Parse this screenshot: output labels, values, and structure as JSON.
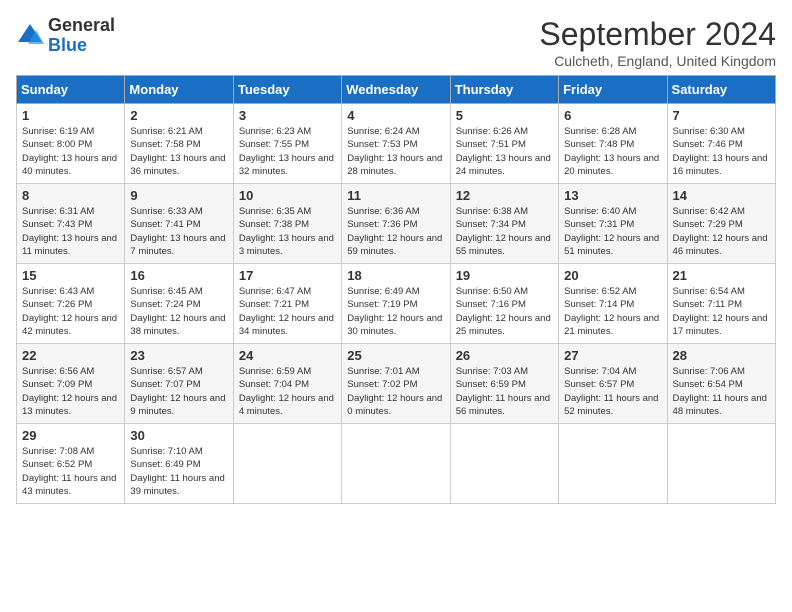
{
  "header": {
    "logo": {
      "general": "General",
      "blue": "Blue"
    },
    "title": "September 2024",
    "location": "Culcheth, England, United Kingdom"
  },
  "weekdays": [
    "Sunday",
    "Monday",
    "Tuesday",
    "Wednesday",
    "Thursday",
    "Friday",
    "Saturday"
  ],
  "weeks": [
    [
      {
        "day": 1,
        "sunrise": "6:19 AM",
        "sunset": "8:00 PM",
        "daylight": "13 hours and 40 minutes."
      },
      {
        "day": 2,
        "sunrise": "6:21 AM",
        "sunset": "7:58 PM",
        "daylight": "13 hours and 36 minutes."
      },
      {
        "day": 3,
        "sunrise": "6:23 AM",
        "sunset": "7:55 PM",
        "daylight": "13 hours and 32 minutes."
      },
      {
        "day": 4,
        "sunrise": "6:24 AM",
        "sunset": "7:53 PM",
        "daylight": "13 hours and 28 minutes."
      },
      {
        "day": 5,
        "sunrise": "6:26 AM",
        "sunset": "7:51 PM",
        "daylight": "13 hours and 24 minutes."
      },
      {
        "day": 6,
        "sunrise": "6:28 AM",
        "sunset": "7:48 PM",
        "daylight": "13 hours and 20 minutes."
      },
      {
        "day": 7,
        "sunrise": "6:30 AM",
        "sunset": "7:46 PM",
        "daylight": "13 hours and 16 minutes."
      }
    ],
    [
      {
        "day": 8,
        "sunrise": "6:31 AM",
        "sunset": "7:43 PM",
        "daylight": "13 hours and 11 minutes."
      },
      {
        "day": 9,
        "sunrise": "6:33 AM",
        "sunset": "7:41 PM",
        "daylight": "13 hours and 7 minutes."
      },
      {
        "day": 10,
        "sunrise": "6:35 AM",
        "sunset": "7:38 PM",
        "daylight": "13 hours and 3 minutes."
      },
      {
        "day": 11,
        "sunrise": "6:36 AM",
        "sunset": "7:36 PM",
        "daylight": "12 hours and 59 minutes."
      },
      {
        "day": 12,
        "sunrise": "6:38 AM",
        "sunset": "7:34 PM",
        "daylight": "12 hours and 55 minutes."
      },
      {
        "day": 13,
        "sunrise": "6:40 AM",
        "sunset": "7:31 PM",
        "daylight": "12 hours and 51 minutes."
      },
      {
        "day": 14,
        "sunrise": "6:42 AM",
        "sunset": "7:29 PM",
        "daylight": "12 hours and 46 minutes."
      }
    ],
    [
      {
        "day": 15,
        "sunrise": "6:43 AM",
        "sunset": "7:26 PM",
        "daylight": "12 hours and 42 minutes."
      },
      {
        "day": 16,
        "sunrise": "6:45 AM",
        "sunset": "7:24 PM",
        "daylight": "12 hours and 38 minutes."
      },
      {
        "day": 17,
        "sunrise": "6:47 AM",
        "sunset": "7:21 PM",
        "daylight": "12 hours and 34 minutes."
      },
      {
        "day": 18,
        "sunrise": "6:49 AM",
        "sunset": "7:19 PM",
        "daylight": "12 hours and 30 minutes."
      },
      {
        "day": 19,
        "sunrise": "6:50 AM",
        "sunset": "7:16 PM",
        "daylight": "12 hours and 25 minutes."
      },
      {
        "day": 20,
        "sunrise": "6:52 AM",
        "sunset": "7:14 PM",
        "daylight": "12 hours and 21 minutes."
      },
      {
        "day": 21,
        "sunrise": "6:54 AM",
        "sunset": "7:11 PM",
        "daylight": "12 hours and 17 minutes."
      }
    ],
    [
      {
        "day": 22,
        "sunrise": "6:56 AM",
        "sunset": "7:09 PM",
        "daylight": "12 hours and 13 minutes."
      },
      {
        "day": 23,
        "sunrise": "6:57 AM",
        "sunset": "7:07 PM",
        "daylight": "12 hours and 9 minutes."
      },
      {
        "day": 24,
        "sunrise": "6:59 AM",
        "sunset": "7:04 PM",
        "daylight": "12 hours and 4 minutes."
      },
      {
        "day": 25,
        "sunrise": "7:01 AM",
        "sunset": "7:02 PM",
        "daylight": "12 hours and 0 minutes."
      },
      {
        "day": 26,
        "sunrise": "7:03 AM",
        "sunset": "6:59 PM",
        "daylight": "11 hours and 56 minutes."
      },
      {
        "day": 27,
        "sunrise": "7:04 AM",
        "sunset": "6:57 PM",
        "daylight": "11 hours and 52 minutes."
      },
      {
        "day": 28,
        "sunrise": "7:06 AM",
        "sunset": "6:54 PM",
        "daylight": "11 hours and 48 minutes."
      }
    ],
    [
      {
        "day": 29,
        "sunrise": "7:08 AM",
        "sunset": "6:52 PM",
        "daylight": "11 hours and 43 minutes."
      },
      {
        "day": 30,
        "sunrise": "7:10 AM",
        "sunset": "6:49 PM",
        "daylight": "11 hours and 39 minutes."
      },
      null,
      null,
      null,
      null,
      null
    ]
  ]
}
